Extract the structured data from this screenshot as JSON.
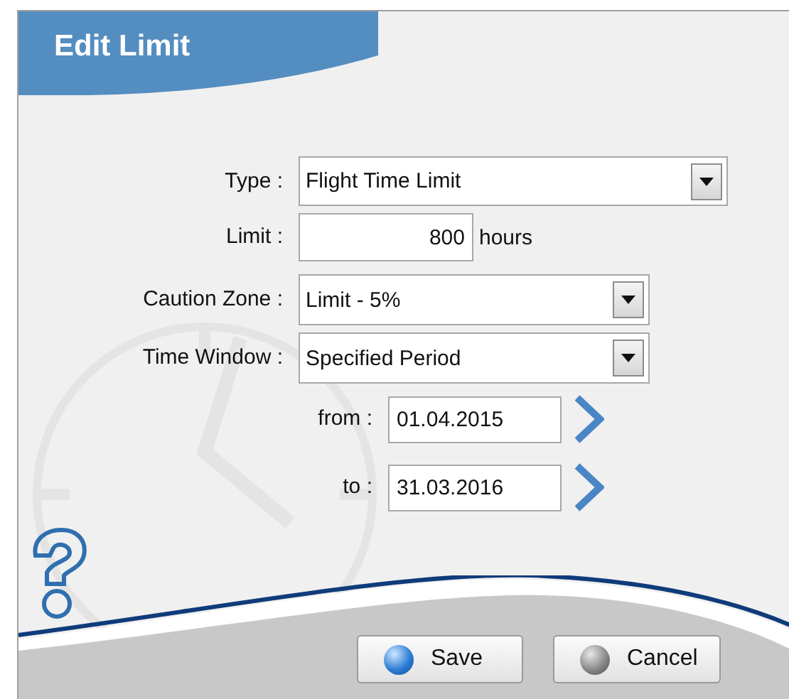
{
  "dialog": {
    "title": "Edit Limit"
  },
  "fields": [
    {
      "kind": "select",
      "label": "Type :",
      "value": "Flight Time Limit"
    },
    {
      "kind": "number",
      "label": "Limit :",
      "value": "800",
      "unit": "hours"
    },
    {
      "kind": "select",
      "label": "Caution Zone :",
      "value": "Limit - 5%"
    },
    {
      "kind": "select",
      "label": "Time Window :",
      "value": "Specified Period"
    },
    {
      "kind": "date",
      "label": "from :",
      "value": "01.04.2015"
    },
    {
      "kind": "date",
      "label": "to :",
      "value": "31.03.2016"
    }
  ],
  "buttons": [
    {
      "kind": "primary",
      "label": "Save"
    },
    {
      "kind": "secondary",
      "label": "Cancel"
    }
  ]
}
